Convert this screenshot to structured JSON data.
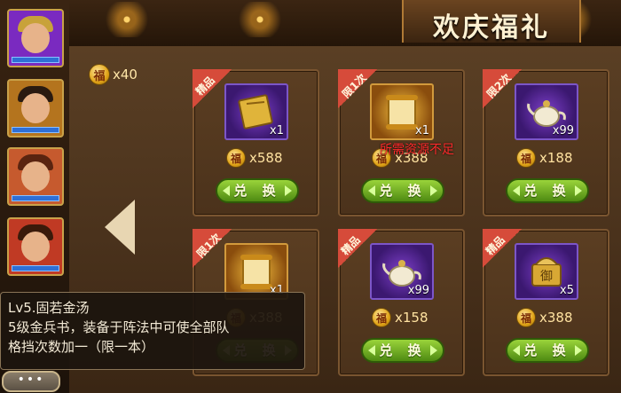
{
  "header": {
    "title": "欢庆福礼"
  },
  "currency": {
    "icon_glyph": "福",
    "amount": "x40"
  },
  "navigation": {
    "prev_arrow": "left-arrow-icon"
  },
  "cards": [
    {
      "ribbon": "精品",
      "item": "scroll-book",
      "quantity": "x1",
      "price": "x588",
      "button": "兑 换"
    },
    {
      "ribbon": "限1次",
      "item": "scroll",
      "quantity": "x1",
      "price": "x388",
      "button": "兑 换"
    },
    {
      "ribbon": "限2次",
      "item": "teapot",
      "quantity": "x99",
      "price": "x188",
      "button": "兑 换"
    },
    {
      "ribbon": "限1次",
      "item": "scroll",
      "quantity": "x1",
      "price": "x388",
      "button": "兑 换"
    },
    {
      "ribbon": "精品",
      "item": "teapot",
      "quantity": "x99",
      "price": "x158",
      "button": "兑 换"
    },
    {
      "ribbon": "精品",
      "item": "imperial-seal",
      "quantity": "x5",
      "price": "x388",
      "button": "兑 换"
    }
  ],
  "warning": "所需资源不足",
  "tooltip": {
    "line1": "Lv5.固若金汤",
    "line2": "5级金兵书，装备于阵法中可使全部队",
    "line3": "格挡次数加一（限一本）"
  },
  "more_button": "•••",
  "seal_glyph": "御",
  "colors": {
    "ribbon": "#d64b3a",
    "button_green": "#7bbd28",
    "warning": "#ff2b2b",
    "gold_text": "#ffe2a0"
  }
}
